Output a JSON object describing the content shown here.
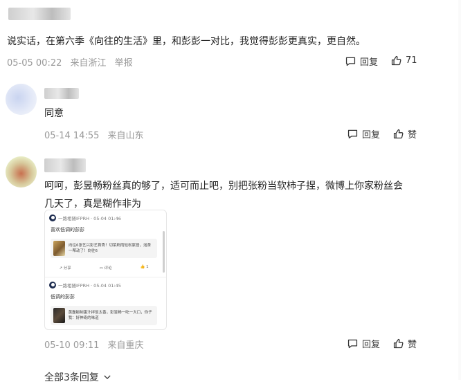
{
  "colors": {
    "meta_gray": "#999999",
    "text": "#222222",
    "link": "#333333"
  },
  "comment1": {
    "text": "说实话，在第六季《向往的生活》里，和彭彭一对比，我觉得彭彭更真实，更自然。",
    "date": "05-05 00:22",
    "location": "来自浙江",
    "report": "举报",
    "reply_label": "回复",
    "like_count": "71"
  },
  "reply1": {
    "text": "同意",
    "date": "05-14 14:55",
    "location": "来自山东",
    "reply_label": "回复",
    "like_label": "赞"
  },
  "reply2": {
    "text_line1": "呵呵，彭昱畅粉丝真的够了，适可而止吧，别把张粉当软柿子捏，微博上你家粉丝会",
    "text_line2": "几天了，真是糊作非为",
    "date": "05-10 09:11",
    "location": "来自重庆",
    "reply_label": "回复",
    "like_label": "赞",
    "embed": [
      {
        "user": "一路相随IFPRH · 05-04 01:46",
        "text": "喜欢低调的彭彭",
        "card_text": "向往6张艺兴彭艺首秀！切菜刷雨轻松家居，泡茶一帮动了！向往6",
        "share": "分享",
        "comment": "评论",
        "like": "1"
      },
      {
        "user": "一路相随IFPRH · 05-04 01:45",
        "text": "低调的彭彭",
        "card_text": "黄磊秘制蛋汁拌饭太香，彭昱畅一吃一大口，你子我：好神奇的味道"
      }
    ]
  },
  "footer": {
    "all_replies": "全部3条回复"
  },
  "icons": {
    "reply": "comment-bubble-icon",
    "like": "thumbs-up-icon",
    "expand": "chevron-down-icon"
  }
}
